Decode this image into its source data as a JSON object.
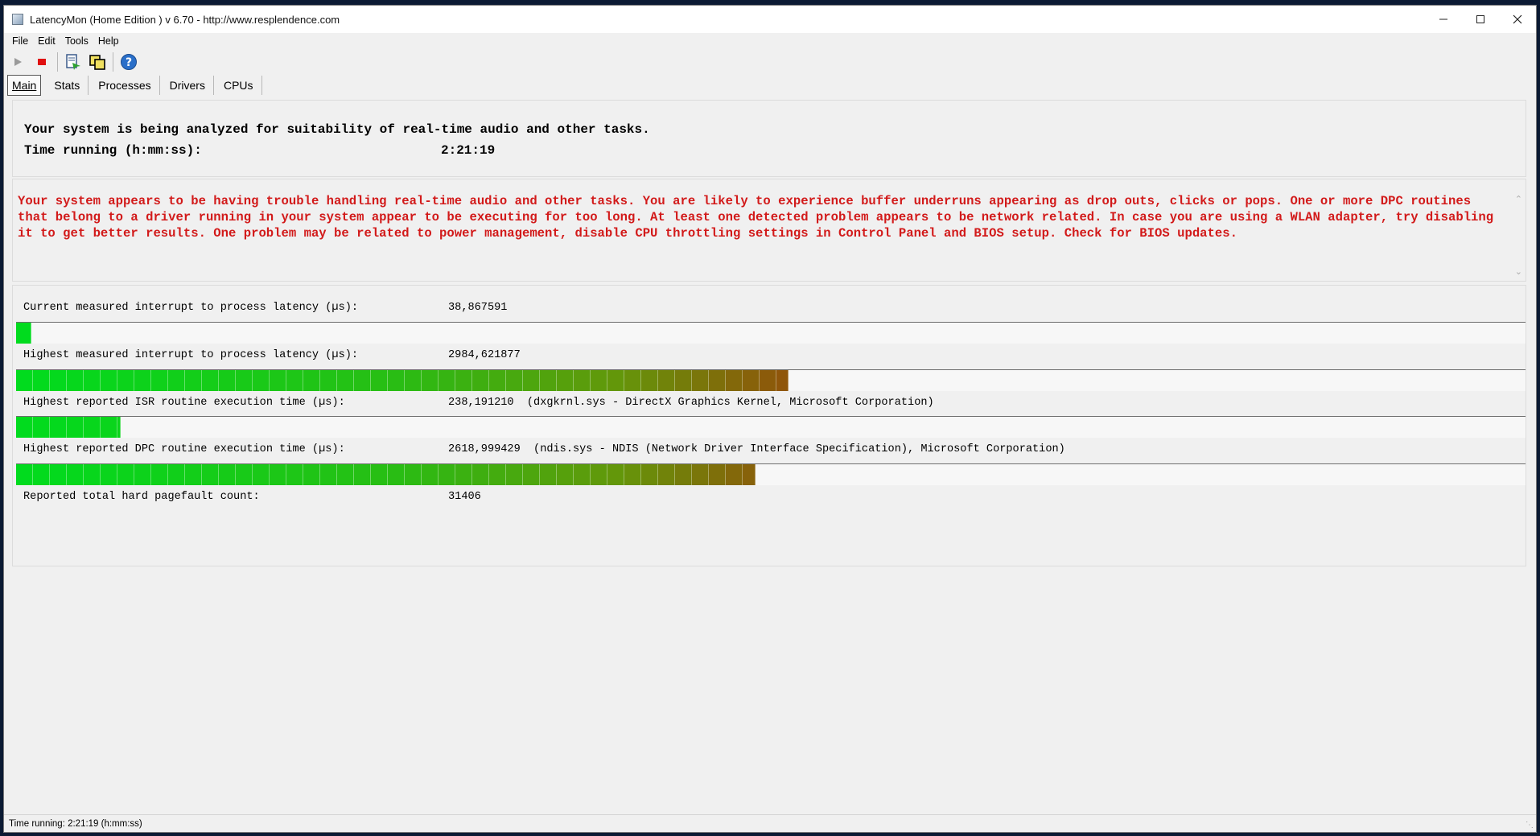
{
  "window": {
    "title": "LatencyMon  (Home Edition )  v 6.70 - http://www.resplendence.com"
  },
  "menu": [
    "File",
    "Edit",
    "Tools",
    "Help"
  ],
  "toolbar": {
    "icons": [
      "play-icon",
      "stop-icon",
      "report-icon",
      "copy-icon",
      "help-icon"
    ],
    "colors": {
      "stop": "#e01010",
      "help": "#2a6fc9"
    }
  },
  "tabs": [
    {
      "label": "Main",
      "active": true
    },
    {
      "label": "Stats",
      "active": false
    },
    {
      "label": "Processes",
      "active": false
    },
    {
      "label": "Drivers",
      "active": false
    },
    {
      "label": "CPUs",
      "active": false
    }
  ],
  "summary": {
    "analyzing": "Your system is being analyzed for suitability of real-time audio and other tasks.",
    "time_label": "Time running (h:mm:ss):",
    "time_value": "2:21:19"
  },
  "warning": {
    "text": "Your system appears to be having trouble handling real-time audio and other tasks. You are likely to experience buffer underruns appearing as drop outs, clicks or pops. One or more DPC routines that belong to a driver running in your system appear to be executing for too long. At least one detected problem appears to be network related. In case you are using a WLAN adapter, try disabling it to get better results. One problem may be related to power management, disable CPU throttling settings in Control Panel and BIOS setup. Check for BIOS updates.",
    "color": "#d21a1a"
  },
  "metrics": [
    {
      "label": "Current measured interrupt to process latency (µs):",
      "value": "38,867591",
      "bar_fraction": 0.0104
    },
    {
      "label": "Highest measured interrupt to process latency (µs):",
      "value": "2984,621877",
      "bar_fraction": 0.5125
    },
    {
      "label": "Highest reported ISR routine execution time (µs):",
      "value": "238,191210  (dxgkrnl.sys - DirectX Graphics Kernel, Microsoft Corporation)",
      "bar_fraction": 0.0695
    },
    {
      "label": "Highest reported DPC routine execution time (µs):",
      "value": "2618,999429  (ndis.sys - NDIS (Network Driver Interface Specification), Microsoft Corporation)",
      "bar_fraction": 0.4902
    },
    {
      "label": "Reported total hard pagefault count:",
      "value": "31406"
    }
  ],
  "status": {
    "text": "Time running: 2:21:19  (h:mm:ss)"
  }
}
